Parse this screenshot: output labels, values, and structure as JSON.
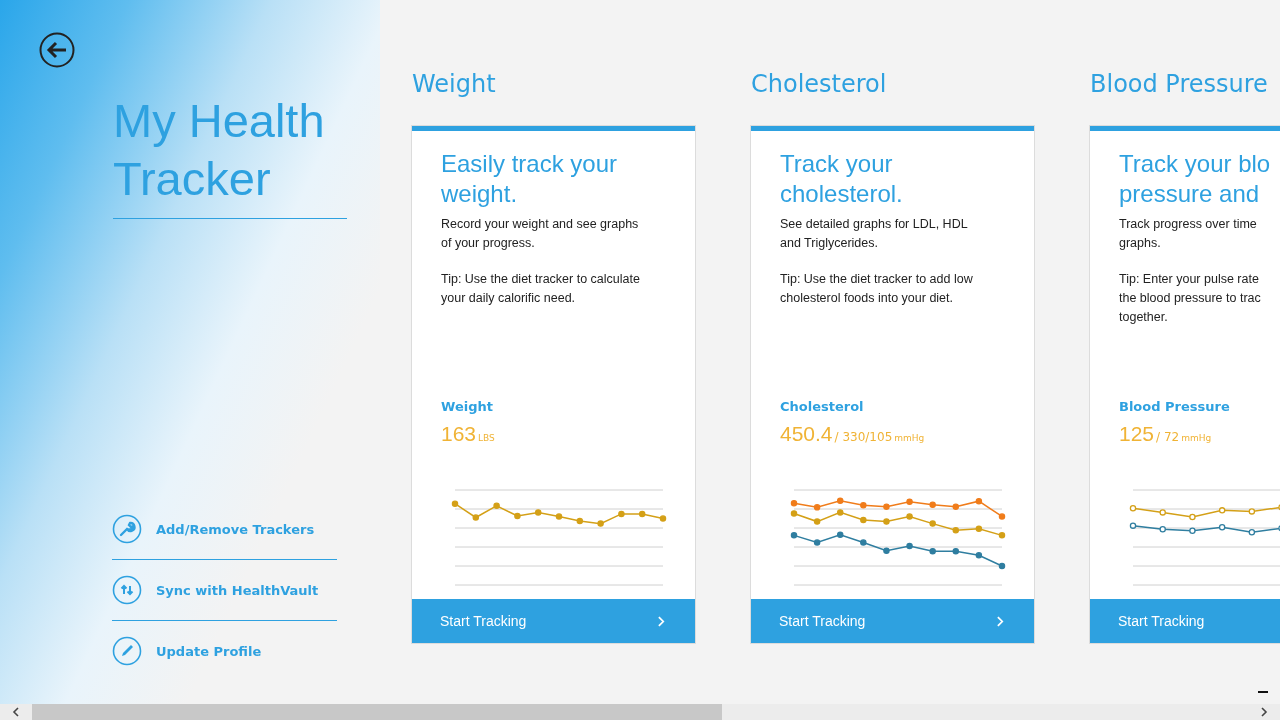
{
  "app": {
    "title_lines": [
      "My Health",
      "Tracker"
    ]
  },
  "actions": [
    {
      "label": "Add/Remove Trackers",
      "kind": "wrench"
    },
    {
      "label": "Sync with HealthVault",
      "kind": "sync"
    },
    {
      "label": "Update Profile",
      "kind": "pencil"
    }
  ],
  "trackers": [
    {
      "section": "Weight",
      "heading_lines": [
        "Easily track your",
        "weight."
      ],
      "paragraphs": [
        [
          "Record your weight and see graphs",
          "of your progress."
        ],
        [
          "Tip: Use the diet tracker to calculate",
          "your daily calorific need."
        ]
      ],
      "metric": "Weight",
      "value": "163",
      "unit": "LBS",
      "button": "Start Tracking"
    },
    {
      "section": "Cholesterol",
      "heading_lines": [
        "Track your",
        "cholesterol."
      ],
      "paragraphs": [
        [
          "See detailed graphs for LDL, HDL",
          "and Triglycerides."
        ],
        [
          "Tip: Use the diet tracker to add low",
          "cholesterol foods into your diet."
        ]
      ],
      "metric": "Cholesterol",
      "value": "450.4",
      "secondary": "/ 330/105",
      "unit": "mmHg",
      "button": "Start Tracking"
    },
    {
      "section": "Blood Pressure",
      "heading_lines": [
        "Track your blo",
        "pressure and"
      ],
      "paragraphs": [
        [
          "Track progress over time",
          "graphs."
        ],
        [
          "Tip: Enter your pulse rate",
          "the blood pressure to trac",
          "together."
        ]
      ],
      "metric": "Blood Pressure",
      "value": "125",
      "secondary": "/ 72",
      "unit": "mmHg",
      "button": "Start Tracking"
    }
  ]
}
